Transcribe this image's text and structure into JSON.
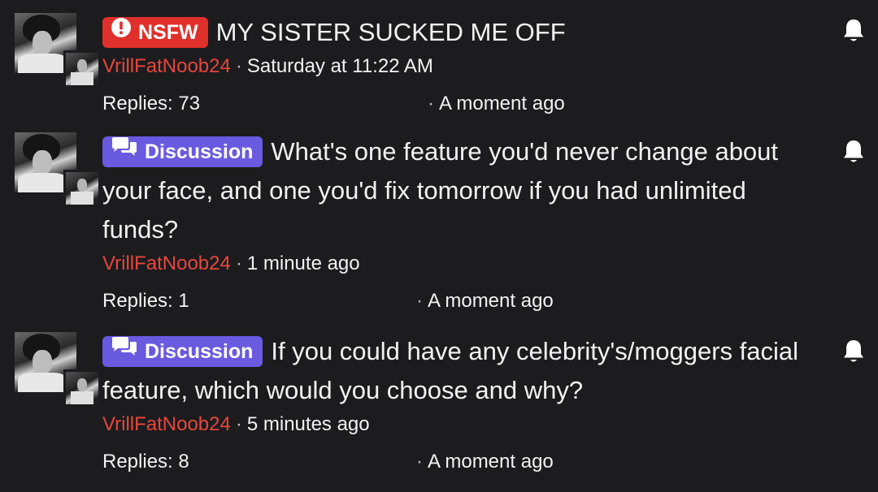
{
  "threads": [
    {
      "badge": "NSFW",
      "badge_color": "#e0302b",
      "badge_icon": "exclamation-circle-icon",
      "title": "MY SISTER SUCKED ME OFF",
      "author": "VrillFatNoob24",
      "posted": "Saturday at 11:22 AM",
      "replies": "Replies: 73",
      "last_activity": "A moment ago"
    },
    {
      "badge": "Discussion",
      "badge_color": "#6a5ae0",
      "badge_icon": "chat-bubbles-icon",
      "title": "What's one feature you'd never change about your face, and one you'd fix tomorrow if you had unlimited funds?",
      "author": "VrillFatNoob24",
      "posted": "1 minute ago",
      "replies": "Replies: 1",
      "last_activity": "A moment ago"
    },
    {
      "badge": "Discussion",
      "badge_color": "#6a5ae0",
      "badge_icon": "chat-bubbles-icon",
      "title": "If you could have any celebrity's/moggers facial feature, which would you choose and why?",
      "author": "VrillFatNoob24",
      "posted": "5 minutes ago",
      "replies": "Replies: 8",
      "last_activity": "A moment ago"
    }
  ],
  "colors": {
    "background": "#1c1c1e",
    "username": "#e8463d",
    "text": "#f2f2f2"
  },
  "icons": {
    "watch": "bell-icon"
  }
}
